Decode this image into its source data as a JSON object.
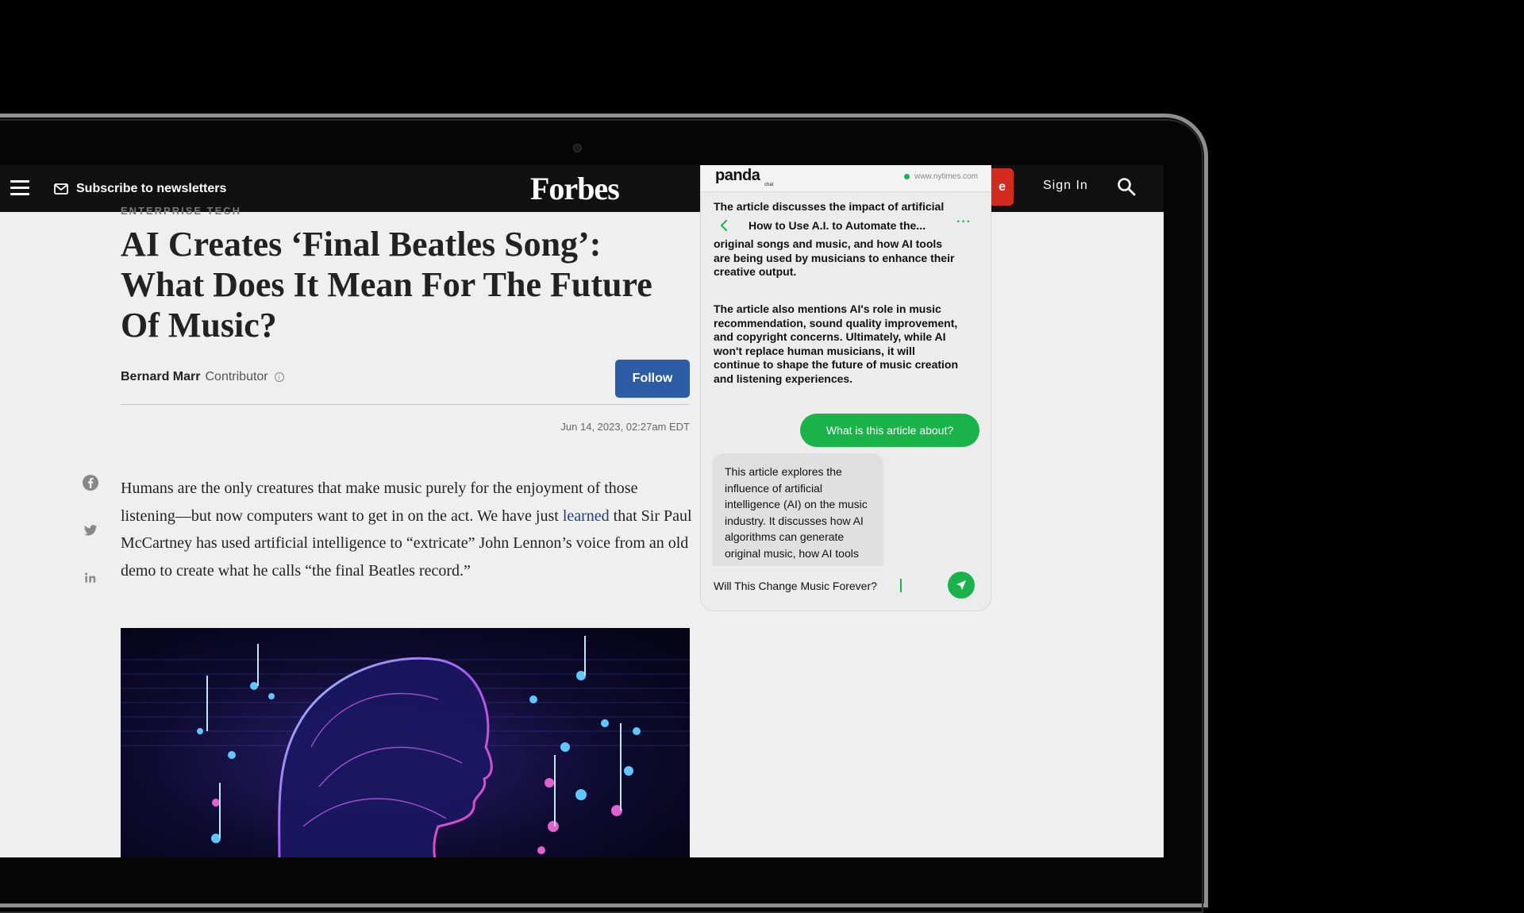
{
  "nav": {
    "newsletter_label": "Subscribe to newsletters",
    "logo": "Forbes",
    "subscribe_label": "e",
    "signin_label": "Sign In"
  },
  "article": {
    "eyebrow": "ENTERPRISE TECH",
    "headline": "AI Creates ‘Final Beatles Song’: What Does It Mean For The Future Of Music?",
    "author": "Bernard Marr",
    "role": "Contributor",
    "follow_label": "Follow",
    "date": "Jun 14, 2023, 02:27am EDT",
    "body_1": "Humans are the only creatures that make music purely for the enjoyment of those listening—but now computers want to get in on the act. We have just ",
    "body_link": "learned",
    "body_2": " that Sir Paul McCartney has used artificial intelligence to “extricate” John Lennon’s voice from an old demo to create what he calls “the final Beatles record.”"
  },
  "panda": {
    "logo": "panda",
    "logo_sub": "chat",
    "site": "www.nytimes.com",
    "summary_head": "The article discusses the impact of artificial",
    "thread_title": "How to Use A.I. to Automate the...",
    "summary_p1": "intelligence (AI) on the music industry. It highlights how AI algorithms can create original songs and music, and how AI tools are being used by musicians to enhance their creative output.",
    "summary_p2": "The article also mentions AI's role in music recommendation, sound quality improvement, and copyright concerns. Ultimately, while AI won't replace human musicians, it will continue to shape the future of music creation and listening experiences.",
    "user_message": "What is this article about?",
    "bot_message": "This article explores the influence of artificial intelligence (AI) on the music industry. It discusses how AI algorithms can generate original music, how AI tools are used by musicians to augment their creativity, and the impact of AI on music",
    "input_value": "Will This Change Music Forever?"
  },
  "colors": {
    "forbes_blue": "#2c5da4",
    "subscribe_red": "#d32b20",
    "panda_green": "#19b34a"
  }
}
